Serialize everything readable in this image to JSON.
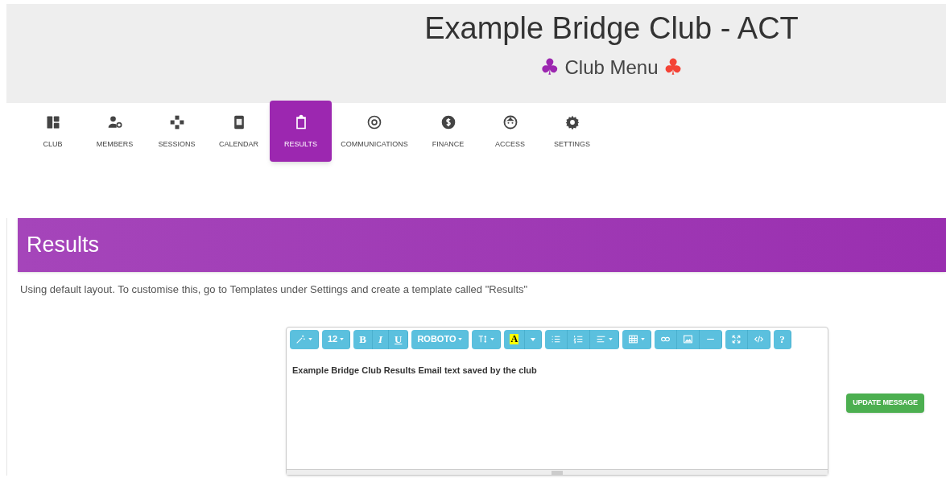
{
  "header": {
    "title": "Example Bridge Club - ACT",
    "menu_label": "Club Menu",
    "suits": [
      {
        "symbol": "♣",
        "color": "#9c27b0"
      },
      {
        "symbol": "♣",
        "color": "#f44336"
      }
    ]
  },
  "nav": [
    {
      "label": "CLUB",
      "selected": false
    },
    {
      "label": "MEMBERS",
      "selected": false
    },
    {
      "label": "SESSIONS",
      "selected": false
    },
    {
      "label": "CALENDAR",
      "selected": false
    },
    {
      "label": "RESULTS",
      "selected": true
    },
    {
      "label": "COMMUNICATIONS",
      "selected": false
    },
    {
      "label": "FINANCE",
      "selected": false
    },
    {
      "label": "ACCESS",
      "selected": false
    },
    {
      "label": "SETTINGS",
      "selected": false
    }
  ],
  "panel": {
    "title": "Results",
    "note": "Using default layout. To customise this, go to Templates under Settings and create a template called \"Results\""
  },
  "editor": {
    "toolbar": [
      [
        {
          "kind": "magic",
          "dropdown": true
        }
      ],
      [
        {
          "kind": "text",
          "label": "12",
          "dropdown": true
        }
      ],
      [
        {
          "kind": "bold",
          "label": "B"
        },
        {
          "kind": "italic",
          "label": "I"
        },
        {
          "kind": "underline",
          "label": "U"
        }
      ],
      [
        {
          "kind": "text",
          "label": "ROBOTO",
          "dropdown": true
        }
      ],
      [
        {
          "kind": "line-height",
          "dropdown": true
        }
      ],
      [
        {
          "kind": "highlight",
          "label": "A"
        },
        {
          "kind": "caret"
        }
      ],
      [
        {
          "kind": "bullets"
        },
        {
          "kind": "numbers"
        },
        {
          "kind": "align",
          "dropdown": true
        }
      ],
      [
        {
          "kind": "table",
          "dropdown": true
        }
      ],
      [
        {
          "kind": "link"
        },
        {
          "kind": "image"
        },
        {
          "kind": "rule"
        }
      ],
      [
        {
          "kind": "fullscreen"
        },
        {
          "kind": "code"
        }
      ],
      [
        {
          "kind": "help",
          "label": "?"
        }
      ]
    ],
    "content": "Example Bridge Club Results Email text saved by the club"
  },
  "button": "UPDATE MESSAGE"
}
